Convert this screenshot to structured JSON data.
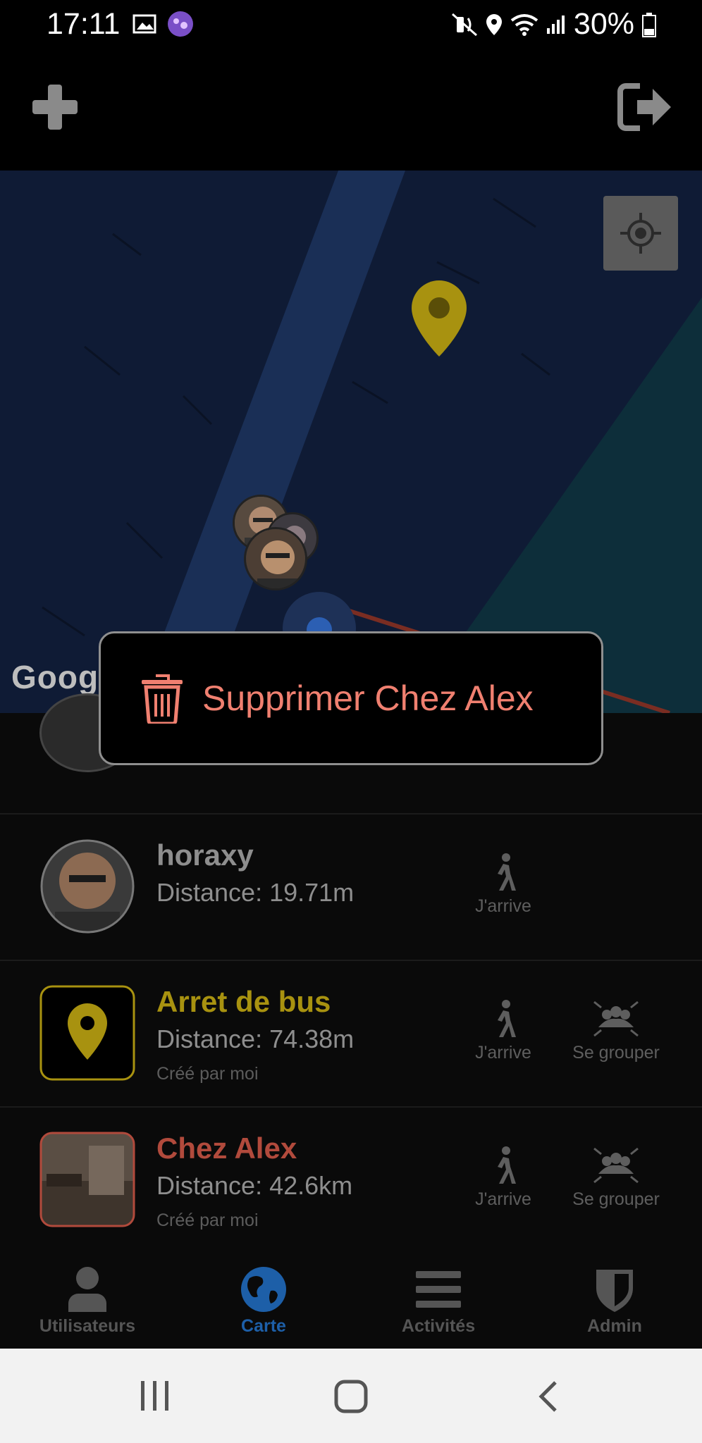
{
  "status_bar": {
    "time": "17:11",
    "battery": "30%",
    "icons": [
      "gallery-icon",
      "app-notification-icon",
      "mute-icon",
      "location-icon",
      "wifi-icon",
      "signal-icon",
      "battery-icon"
    ]
  },
  "top_bar": {
    "icons": [
      "add-icon",
      "logout-icon"
    ]
  },
  "map": {
    "attribution": "Googl",
    "locate_icon": "my-location-icon"
  },
  "context_menu": {
    "delete_label": "Supprimer Chez Alex"
  },
  "list": {
    "rows": [
      {
        "name": "horaxy",
        "distance": "Distance: 19.71m",
        "actions": [
          "J'arrive"
        ]
      },
      {
        "name": "Arret de bus",
        "distance": "Distance: 74.38m",
        "created_by": "Créé par moi",
        "actions": [
          "J'arrive",
          "Se grouper"
        ]
      },
      {
        "name": "Chez Alex",
        "distance": "Distance: 42.6km",
        "created_by": "Créé par moi",
        "actions": [
          "J'arrive",
          "Se grouper"
        ]
      }
    ]
  },
  "bottom_nav": {
    "items": [
      {
        "label": "Utilisateurs",
        "icon": "user-icon"
      },
      {
        "label": "Carte",
        "icon": "globe-icon",
        "active": true
      },
      {
        "label": "Activités",
        "icon": "menu-icon"
      },
      {
        "label": "Admin",
        "icon": "shield-icon"
      }
    ]
  },
  "colors": {
    "accent_yellow": "#b09a10",
    "accent_red": "#b14a3c",
    "active_blue": "#1d5fa8",
    "menu_text": "#f08070"
  }
}
